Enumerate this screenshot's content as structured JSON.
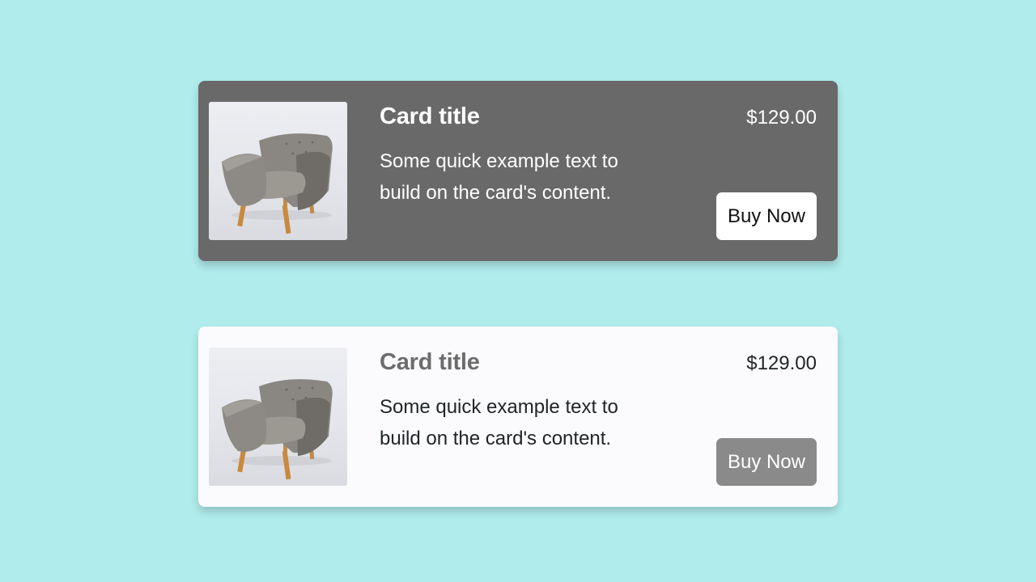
{
  "cards": [
    {
      "theme": "dark",
      "title": "Card title",
      "text": "Some quick example text to build on the card's content.",
      "price": "$129.00",
      "button_label": "Buy Now",
      "image_subject": "armchair"
    },
    {
      "theme": "light",
      "title": "Card title",
      "text": "Some quick example text to build on the card's content.",
      "price": "$129.00",
      "button_label": "Buy Now",
      "image_subject": "armchair"
    }
  ],
  "colors": {
    "page_background": "#b0ecec",
    "dark_card": "#696969",
    "light_card": "#fbfbfd",
    "light_button": "#8a8a8a",
    "dark_button": "#ffffff"
  }
}
